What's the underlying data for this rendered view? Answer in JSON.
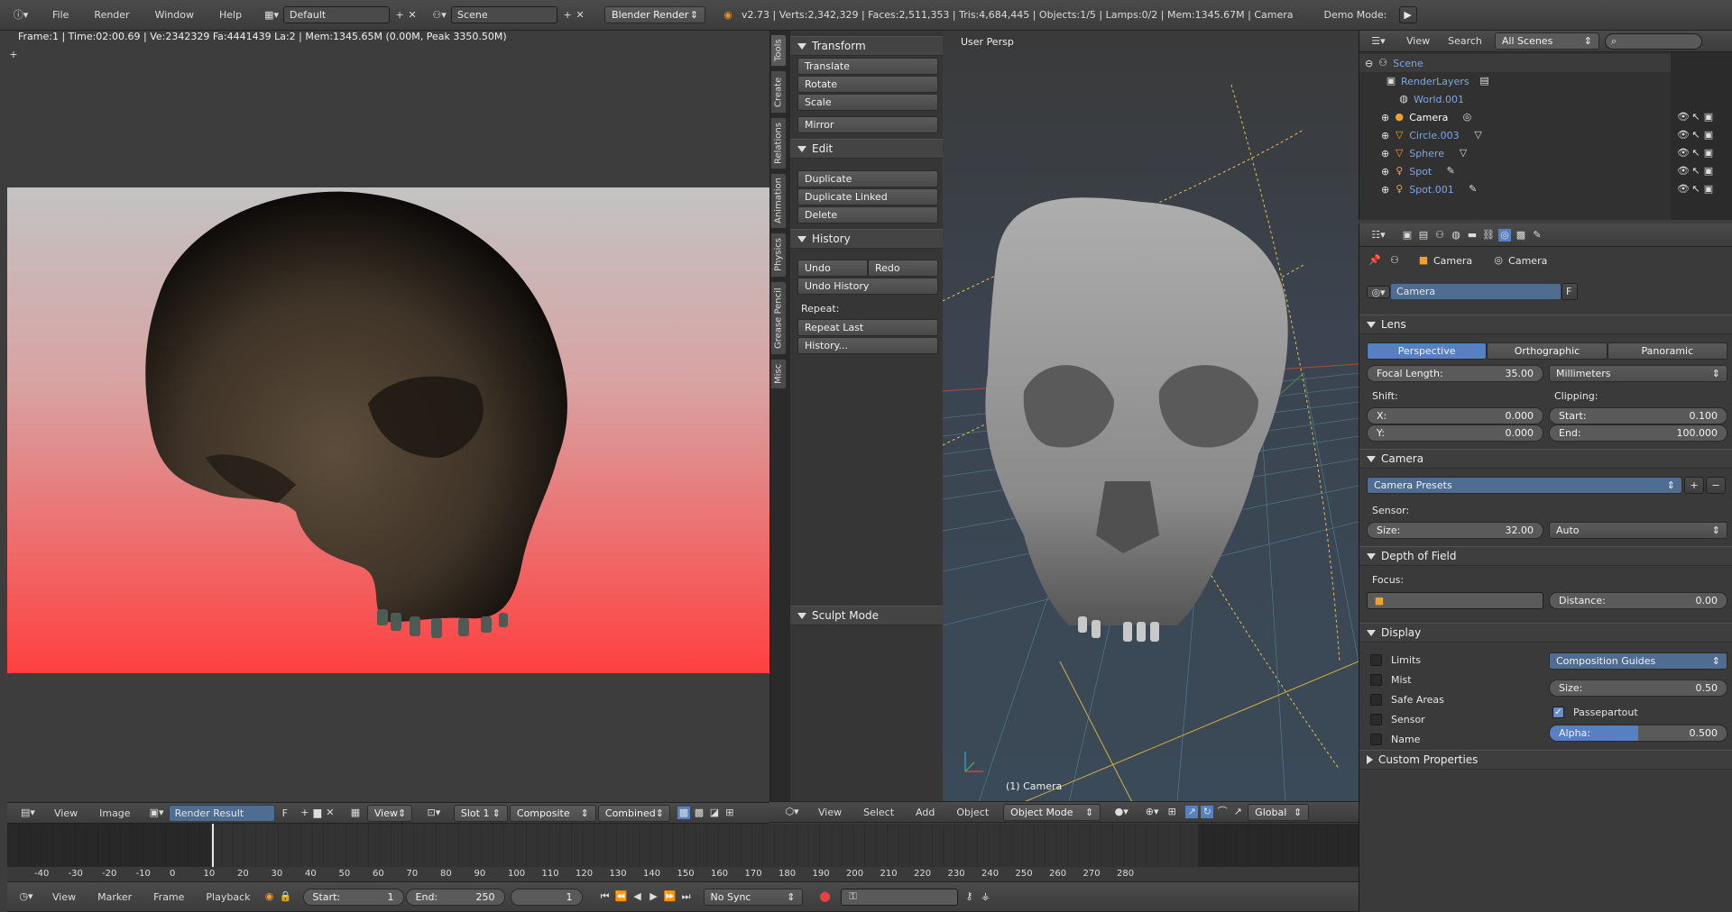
{
  "topbar": {
    "menus": [
      "File",
      "Render",
      "Window",
      "Help"
    ],
    "layout": "Default",
    "scene": "Scene",
    "engine": "Blender Render",
    "stats": "v2.73 | Verts:2,342,329 | Faces:2,511,353 | Tris:4,684,445 | Objects:1/5 | Lamps:0/2 | Mem:1345.67M | Camera",
    "demo_mode": "Demo Mode:"
  },
  "image_editor": {
    "info": "Frame:1 | Time:02:00.69 | Ve:2342329 Fa:4441439 La:2 | Mem:1345.65M (0.00M, Peak 3350.50M)",
    "header": {
      "view": "View",
      "image": "Image",
      "image_name": "Render Result",
      "f_label": "F",
      "view2": "View",
      "slot": "Slot 1",
      "composite": "Composite",
      "pass": "Combined"
    }
  },
  "toolshelf": {
    "tabs": [
      "Tools",
      "Create",
      "Relations",
      "Animation",
      "Physics",
      "Grease Pencil",
      "Misc"
    ],
    "transform": {
      "title": "Transform",
      "translate": "Translate",
      "rotate": "Rotate",
      "scale": "Scale",
      "mirror": "Mirror"
    },
    "edit": {
      "title": "Edit",
      "duplicate": "Duplicate",
      "duplicate_linked": "Duplicate Linked",
      "delete": "Delete"
    },
    "history": {
      "title": "History",
      "undo": "Undo",
      "redo": "Redo",
      "undo_history": "Undo History",
      "repeat": "Repeat:",
      "repeat_last": "Repeat Last",
      "history": "History..."
    },
    "sculpt": "Sculpt Mode"
  },
  "viewport": {
    "label": "User Persp",
    "object_label": "(1) Camera",
    "header": {
      "view": "View",
      "select": "Select",
      "add": "Add",
      "object": "Object",
      "mode": "Object Mode",
      "orientation": "Global"
    }
  },
  "outliner": {
    "view": "View",
    "search": "Search",
    "filter": "All Scenes",
    "items": [
      {
        "name": "Scene"
      },
      {
        "name": "RenderLayers"
      },
      {
        "name": "World.001"
      },
      {
        "name": "Camera"
      },
      {
        "name": "Circle.003"
      },
      {
        "name": "Sphere"
      },
      {
        "name": "Spot"
      },
      {
        "name": "Spot.001"
      }
    ]
  },
  "properties": {
    "crumb1": "Camera",
    "crumb2": "Camera",
    "datablock": "Camera",
    "f_label": "F",
    "lens": {
      "title": "Lens",
      "tabs": [
        "Perspective",
        "Orthographic",
        "Panoramic"
      ],
      "focal_label": "Focal Length:",
      "focal_value": "35.00",
      "unit": "Millimeters",
      "shift": "Shift:",
      "clipping": "Clipping:",
      "x_label": "X:",
      "x_value": "0.000",
      "y_label": "Y:",
      "y_value": "0.000",
      "start_label": "Start:",
      "start_value": "0.100",
      "end_label": "End:",
      "end_value": "100.000"
    },
    "camera": {
      "title": "Camera",
      "presets": "Camera Presets",
      "sensor": "Sensor:",
      "size_label": "Size:",
      "size_value": "32.00",
      "fit": "Auto"
    },
    "dof": {
      "title": "Depth of Field",
      "focus": "Focus:",
      "distance_label": "Distance:",
      "distance_value": "0.00"
    },
    "display": {
      "title": "Display",
      "limits": "Limits",
      "mist": "Mist",
      "safe_areas": "Safe Areas",
      "sensor": "Sensor",
      "name": "Name",
      "guides": "Composition Guides",
      "size_label": "Size:",
      "size_value": "0.50",
      "passepartout": "Passepartout",
      "alpha_label": "Alpha:",
      "alpha_value": "0.500",
      "alpha_fraction": 0.5
    },
    "custom": "Custom Properties"
  },
  "timeline": {
    "ticks": [
      "-40",
      "-30",
      "-20",
      "-10",
      "0",
      "10",
      "20",
      "30",
      "40",
      "50",
      "60",
      "70",
      "80",
      "90",
      "100",
      "110",
      "120",
      "130",
      "140",
      "150",
      "160",
      "170",
      "180",
      "190",
      "200",
      "210",
      "220",
      "230",
      "240",
      "250",
      "260",
      "270",
      "280"
    ],
    "view": "View",
    "marker": "Marker",
    "frame": "Frame",
    "playback": "Playback",
    "start_label": "Start:",
    "start_value": "1",
    "end_label": "End:",
    "end_value": "250",
    "current": "1",
    "sync": "No Sync"
  },
  "colors": {
    "accent": "#5680c2",
    "bg_gradient_top": "#c2c2c2",
    "bg_gradient_bottom": "#ff3a3a",
    "viewport_bg": "#3b4a56"
  }
}
